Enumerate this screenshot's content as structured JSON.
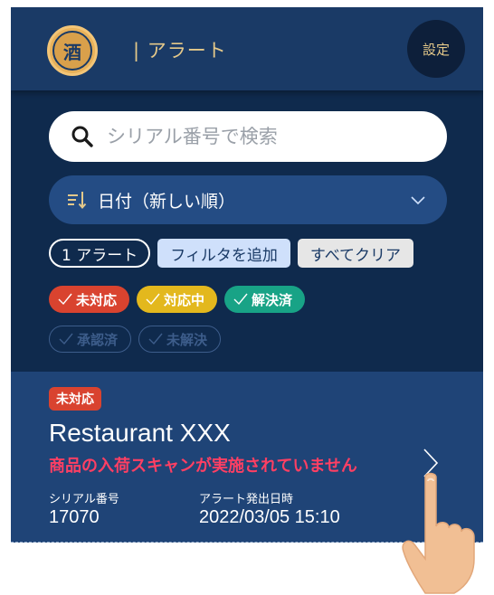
{
  "header": {
    "title": "| アラート",
    "logo_text": "酒",
    "settings_label": "設定"
  },
  "search": {
    "placeholder": "シリアル番号で検索",
    "value": ""
  },
  "sort": {
    "label": "日付（新しい順）"
  },
  "filters": {
    "count_label": "1 アラート",
    "add_filter_label": "フィルタを追加",
    "clear_all_label": "すべてクリア"
  },
  "status_filters": [
    {
      "label": "未対応",
      "active": true,
      "color": "#d9432f"
    },
    {
      "label": "対応中",
      "active": true,
      "color": "#e3b81d"
    },
    {
      "label": "解決済",
      "active": true,
      "color": "#18a386"
    },
    {
      "label": "承認済",
      "active": false
    },
    {
      "label": "未解決",
      "active": false
    }
  ],
  "alert": {
    "badge": "未対応",
    "restaurant": "Restaurant XXX",
    "message": "商品の入荷スキャンが実施されていません",
    "serial_label": "シリアル番号",
    "serial_value": "17070",
    "date_label": "アラート発出日時",
    "date_value": "2022/03/05 15:10"
  },
  "colors": {
    "background": "#0f2a4d",
    "header": "#1a3a66",
    "accent_gold": "#e5c98a",
    "alert_red": "#ff3f63"
  }
}
